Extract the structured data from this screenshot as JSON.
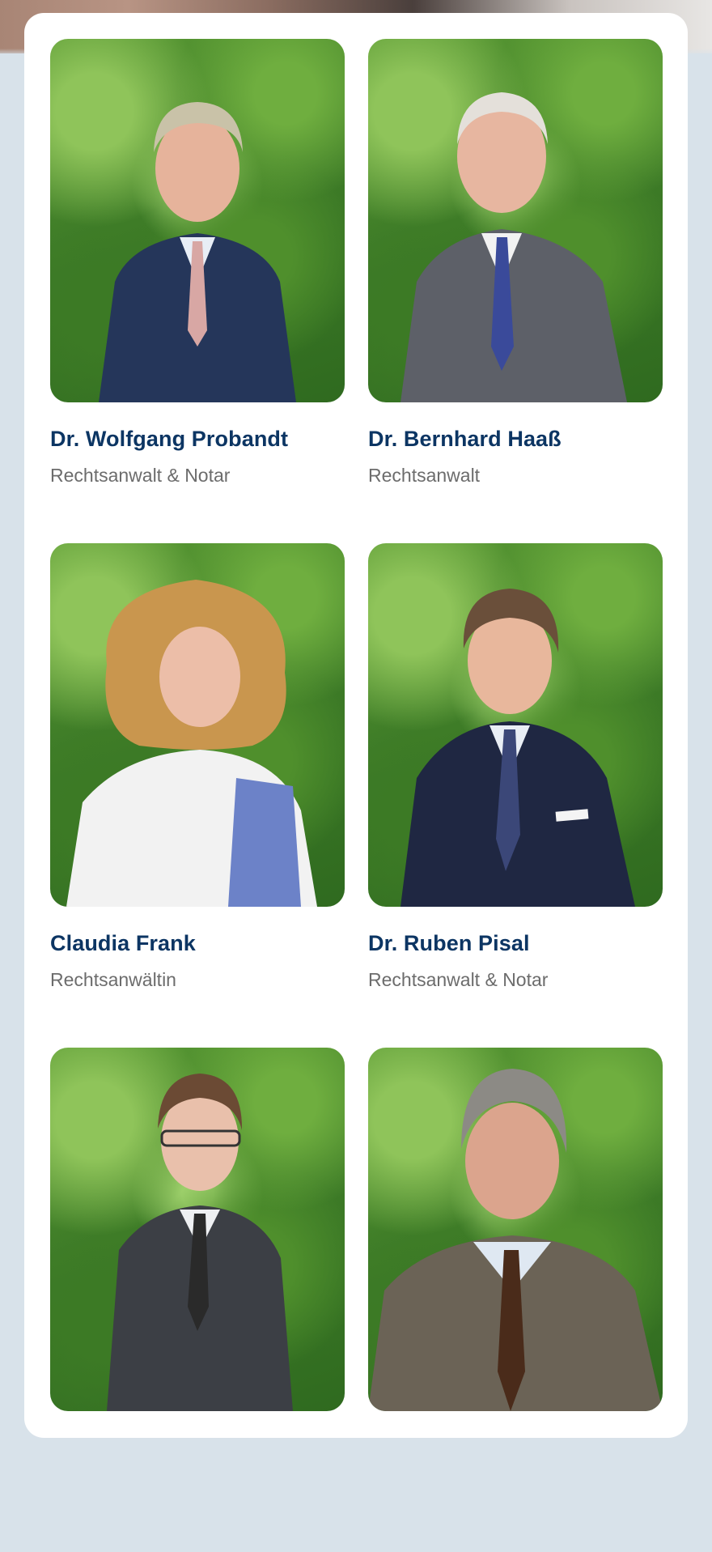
{
  "team": {
    "members": [
      {
        "name": "Dr. Wolfgang Probandt",
        "role": "Rechtsanwalt & Notar",
        "hair": "#c9c2a8",
        "suit": "#25365a",
        "tie": "#d8a7a4",
        "skin": "#e6b39b"
      },
      {
        "name": "Dr. Bernhard Haaß",
        "role": "Rechtsanwalt",
        "hair": "#e4e0da",
        "suit": "#5d6068",
        "tie": "#3a4a9a",
        "skin": "#e7b6a0"
      },
      {
        "name": "Claudia Frank",
        "role": "Rechtsanwältin",
        "hair": "#c9964e",
        "suit": "#f2f2f2",
        "tie": "#6c82c8",
        "skin": "#ecbea8"
      },
      {
        "name": "Dr. Ruben Pisal",
        "role": "Rechtsanwalt & Notar",
        "hair": "#6a4f3a",
        "suit": "#1f2742",
        "tie": "#3b4778",
        "skin": "#e8b79c"
      },
      {
        "name": "",
        "role": "",
        "hair": "#6b4a34",
        "suit": "#3c3f45",
        "tie": "#2a2a2a",
        "skin": "#e9c0ab"
      },
      {
        "name": "",
        "role": "",
        "hair": "#8c8a85",
        "suit": "#6b6356",
        "tie": "#4a2b1a",
        "skin": "#dba48d"
      }
    ]
  }
}
